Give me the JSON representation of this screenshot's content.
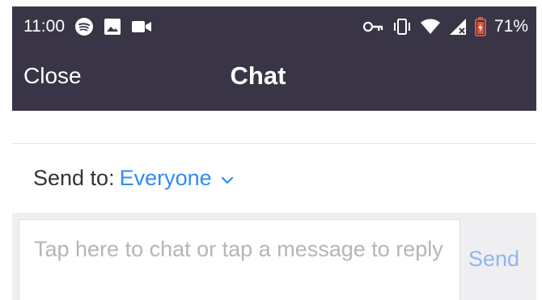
{
  "status_bar": {
    "time": "11:00",
    "battery": "71%",
    "icons_left": [
      "spotify-icon",
      "image-icon",
      "video-camera-icon"
    ],
    "icons_right": [
      "vpn-key-icon",
      "vibrate-icon",
      "wifi-icon",
      "signal-icon",
      "battery-icon"
    ],
    "colors": {
      "battery_accent": "#e0533b"
    }
  },
  "header": {
    "close_label": "Close",
    "title": "Chat",
    "background": "#3a3546"
  },
  "send_to": {
    "label": "Send to:",
    "value": "Everyone",
    "accent": "#2f8cf5"
  },
  "composer": {
    "placeholder": "Tap here to chat or tap a message to reply",
    "send_label": "Send"
  }
}
